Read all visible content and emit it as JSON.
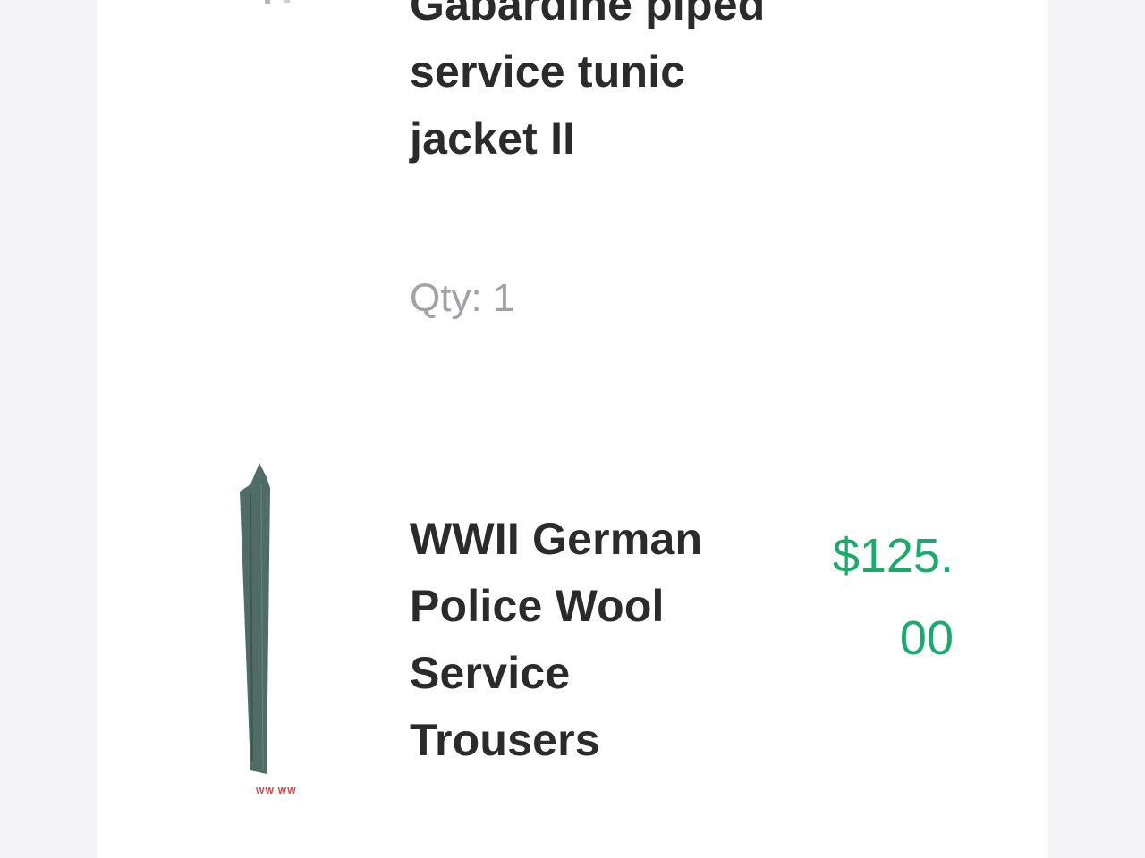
{
  "order_items": [
    {
      "title": "Gabardine piped service tunic jacket II",
      "qty_label": "Qty: 1",
      "thumbnail": "uniform-jacket-photo"
    },
    {
      "title": "WWII German Police Wool Service Trousers",
      "price": "$125.00",
      "thumbnail": "trousers-photo",
      "thumbnail_mark": "WW WW"
    }
  ],
  "colors": {
    "price": "#1aab6c",
    "title": "#2b2b2b",
    "qty": "#a2a2a6",
    "trousers": "#4f6c66"
  }
}
